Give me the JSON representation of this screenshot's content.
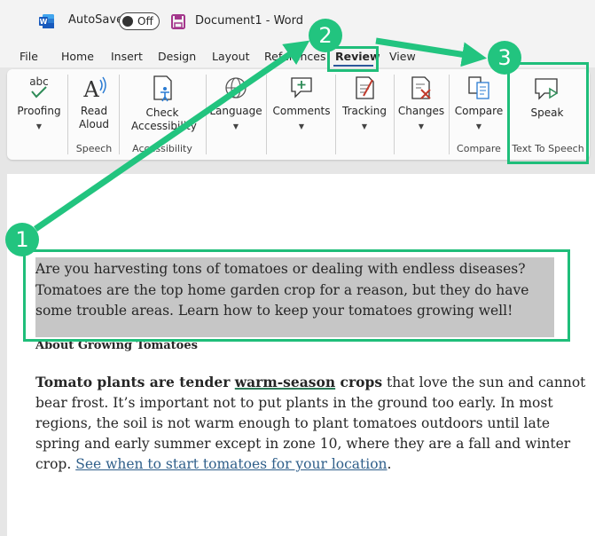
{
  "titlebar": {
    "autosave_label": "AutoSave",
    "autosave_state": "Off",
    "document_title": "Document1 - Word"
  },
  "tabs": [
    {
      "label": "File"
    },
    {
      "label": "Home"
    },
    {
      "label": "Insert"
    },
    {
      "label": "Design"
    },
    {
      "label": "Layout"
    },
    {
      "label": "References"
    },
    {
      "label": "Review",
      "active": true
    },
    {
      "label": "View"
    }
  ],
  "ribbon": {
    "proofing": "Proofing",
    "read_aloud": "Read Aloud",
    "speech_group": "Speech",
    "check_accessibility": "Check Accessibility",
    "accessibility_group": "Accessibility",
    "language": "Language",
    "comments": "Comments",
    "tracking": "Tracking",
    "changes": "Changes",
    "compare": "Compare",
    "compare_group": "Compare",
    "speak": "Speak",
    "text_to_speech_group": "Text To Speech",
    "abc_glyph": "abc"
  },
  "document": {
    "intro": "Are you harvesting tons of tomatoes or dealing with endless diseases? Tomatoes are the top home garden crop for a reason, but they do have some trouble areas. Learn how to keep your tomatoes growing well!",
    "heading": "About Growing Tomatoes",
    "body_bold_1": "Tomato plants are tender ",
    "body_bold_link": "warm-season",
    "body_bold_2": " crops",
    "body_text": " that love the sun and cannot bear frost. It’s important not to put plants in the ground too early. In most regions, the soil is not warm enough to plant tomatoes outdoors until late spring and early summer except in zone 10, where they are a fall and winter crop. ",
    "body_link": "See when to start tomatoes for your location",
    "body_end": "."
  },
  "annotations": {
    "step1": "1",
    "step2": "2",
    "step3": "3"
  },
  "colors": {
    "annotation_green": "#22c47f",
    "accent_blue": "#2b579a",
    "highlight_gray": "#c6c6c6"
  }
}
